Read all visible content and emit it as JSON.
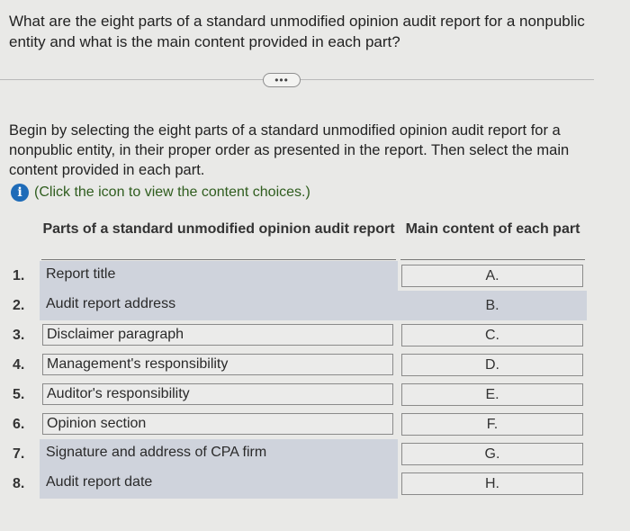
{
  "question": "What are the eight parts of a standard unmodified opinion audit report for a nonpublic entity and what is the main content provided in each part?",
  "more_button_label": "•••",
  "instructions": "Begin by selecting the eight parts of a standard unmodified opinion audit report for a nonpublic entity, in their proper order as presented in the report. Then select the main content provided in each part.",
  "hint": {
    "icon": "info-icon",
    "icon_glyph": "i",
    "text": "(Click the icon to view the content choices.)"
  },
  "table": {
    "columns": {
      "parts": "Parts of a standard unmodified opinion audit report",
      "content": "Main content of each part"
    },
    "rows": [
      {
        "number": "1.",
        "part": "Report title",
        "content": "A."
      },
      {
        "number": "2.",
        "part": "Audit report address",
        "content": "B."
      },
      {
        "number": "3.",
        "part": "Disclaimer paragraph",
        "content": "C."
      },
      {
        "number": "4.",
        "part": "Management's responsibility",
        "content": "D."
      },
      {
        "number": "5.",
        "part": "Auditor's responsibility",
        "content": "E."
      },
      {
        "number": "6.",
        "part": "Opinion section",
        "content": "F."
      },
      {
        "number": "7.",
        "part": "Signature and address of CPA firm",
        "content": "G."
      },
      {
        "number": "8.",
        "part": "Audit report date",
        "content": "H."
      }
    ]
  }
}
